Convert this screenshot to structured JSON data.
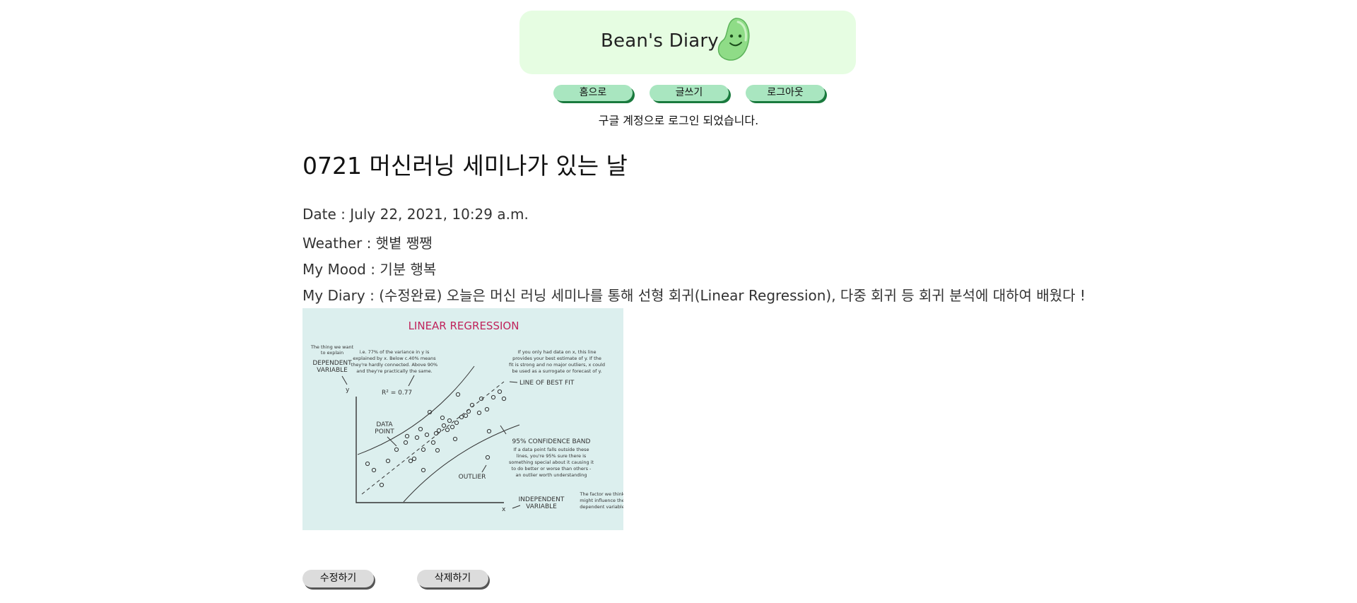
{
  "header": {
    "title": "Bean's Diary",
    "logo_icon": "bean-smiley-icon",
    "brand_color": "#e6fde2"
  },
  "nav": {
    "home": "홈으로",
    "write": "글쓰기",
    "logout": "로그아웃"
  },
  "status_message": "구글 계정으로 로그인 되었습니다.",
  "post": {
    "title": "0721 머신러닝 세미나가 있는 날",
    "date_label": "Date : ",
    "date": "July 22, 2021, 10:29 a.m.",
    "weather_label": "Weather : ",
    "weather": "햇볕 쨍쨍",
    "mood_label": "My Mood : ",
    "mood": "기분 행복",
    "diary_label": "My Diary : ",
    "diary": "(수정완료) 오늘은 머신 러닝 세미나를 통해 선형 회귀(Linear Regression), 다중 회귀 등 회귀 분석에 대하여 배웠다 !"
  },
  "figure": {
    "title": "LINEAR REGRESSION",
    "dep_note1": "The thing we want",
    "dep_note2": "to explain",
    "dep_var1": "DEPENDENT",
    "dep_var2": "VARIABLE",
    "y_axis": "y",
    "r2_note1": "i.e. 77% of the variance in y is",
    "r2_note2": "explained by x. Below c.40% means",
    "r2_note3": "they're hardly connected. Above 90%",
    "r2_note4": "and they're practically the same.",
    "r2_value": "R² = 0.77",
    "fit_note1": "If you only had data on x, this line",
    "fit_note2": "provides your best estimate of y. If the",
    "fit_note3": "fit is strong and no major outliers, x could",
    "fit_note4": "be used as a surrogate or forecast of y.",
    "fit_label": "LINE OF BEST FIT",
    "data_point1": "DATA",
    "data_point2": "POINT",
    "band_label": "95% CONFIDENCE BAND",
    "band_note1": "If a data point falls outside these",
    "band_note2": "lines, you're 95% sure there is",
    "band_note3": "something special about it causing it",
    "band_note4": "to do better or worse than others -",
    "band_note5": "an outlier worth understanding",
    "outlier": "OUTLIER",
    "x_axis": "x",
    "ind_var1": "INDEPENDENT",
    "ind_var2": "VARIABLE",
    "ind_note1": "The factor we think",
    "ind_note2": "might influence the",
    "ind_note3": "dependent variable"
  },
  "actions": {
    "edit": "수정하기",
    "delete": "삭제하기"
  }
}
